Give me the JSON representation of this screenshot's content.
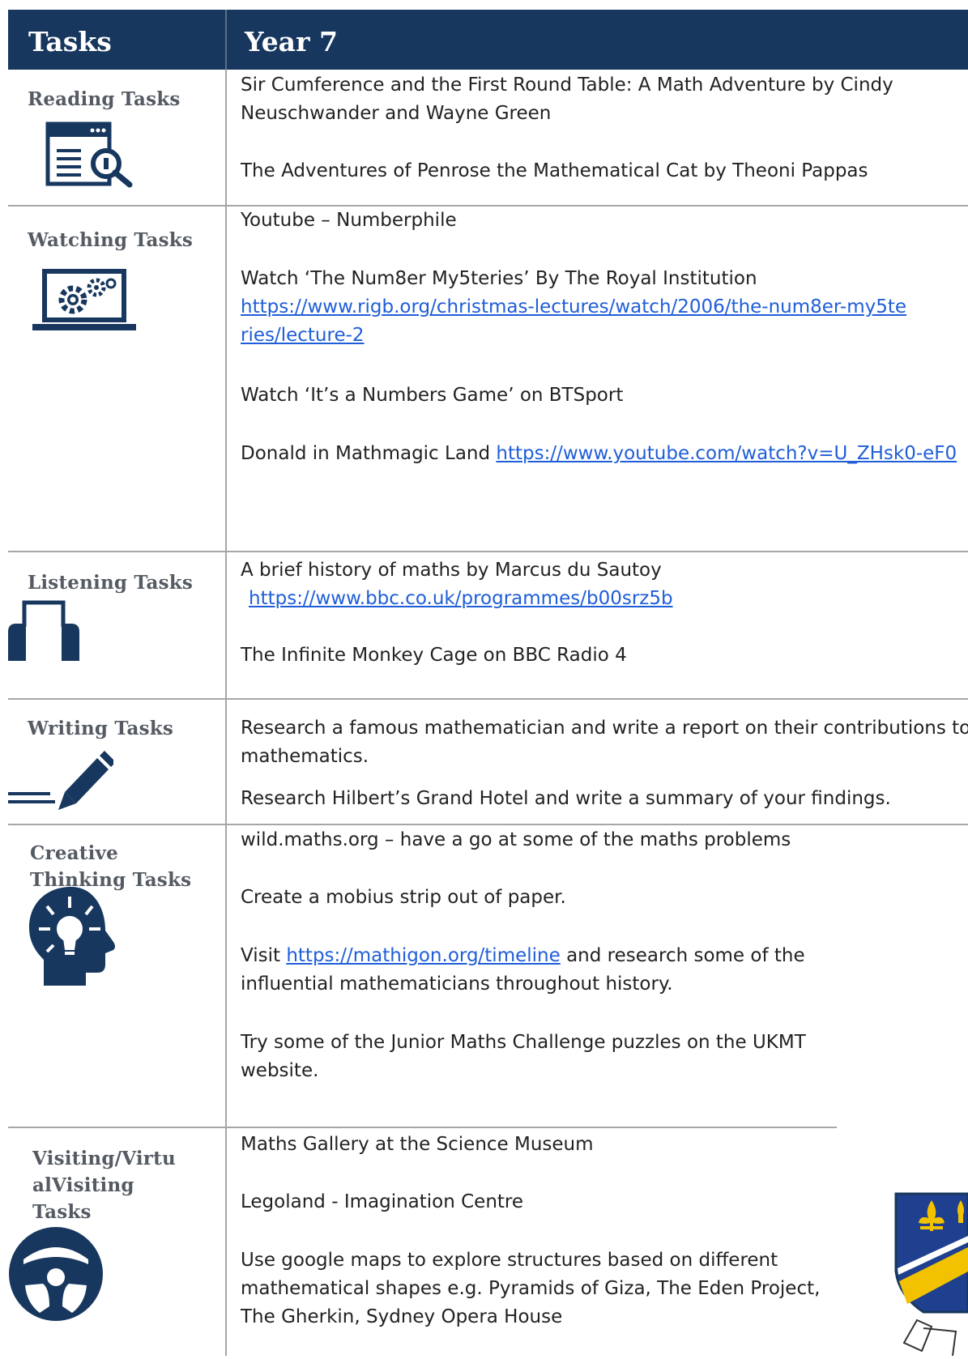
{
  "header": {
    "col1": "Tasks",
    "col2": "Year 7"
  },
  "sections": {
    "reading": {
      "title": "Reading Tasks",
      "icon": "document-search-icon",
      "items": [
        "Sir Cumference and the First Round Table: A Math Adventure by Cindy Neuschwander and Wayne Green",
        "The Adventures of Penrose the Mathematical Cat by Theoni Pappas"
      ]
    },
    "watching": {
      "title": "Watching Tasks",
      "icon": "laptop-gears-icon",
      "item1": "Youtube – Numberphile",
      "item2": "Watch ‘The Num8er My5teries’ By The Royal Institution",
      "item2_link": "https://www.rigb.org/christmas-lectures/watch/2006/the-num8er-my5teries/lecture-2",
      "item3": "Watch ‘It’s a Numbers Game’ on BTSport",
      "item4": "Donald in Mathmagic Land",
      "item4_link": "https://www.youtube.com/watch?v=U_ZHsk0-eF0"
    },
    "listening": {
      "title": "Listening Tasks",
      "icon": "headphones-icon",
      "item1": "A brief history of maths by Marcus du Sautoy",
      "item1_link": "https://www.bbc.co.uk/programmes/b00srz5b",
      "item2": "The Infinite Monkey Cage on BBC Radio 4"
    },
    "writing": {
      "title": "Writing Tasks",
      "icon": "pen-writing-icon",
      "item1": "Research a famous mathematician and write a report on their contributions to mathematics.",
      "item2": "Research Hilbert’s Grand Hotel and write a summary of your findings."
    },
    "creative": {
      "title_line1": "Creative",
      "title_line2": "Thinking Tasks",
      "icon": "head-lightbulb-icon",
      "item1": "wild.maths.org – have a go at some of the maths problems",
      "item2": "Create a mobius strip out of paper.",
      "item3_pre": "Visit",
      "item3_link": "https://mathigon.org/timeline",
      "item3_post": "and research some of the influential mathematicians throughout history.",
      "item4": "Try some of the Junior Maths Challenge puzzles on the UKMT website."
    },
    "visiting": {
      "title_line1": "Visiting/Virtu",
      "title_line2": "alVisiting",
      "title_line3": "Tasks",
      "icon": "steering-wheel-icon",
      "item1": "Maths Gallery at the Science Museum",
      "item2": "Legoland - Imagination Centre",
      "item3": "Use google maps to explore structures based on different mathematical shapes e.g. Pyramids of Giza, The Eden Project, The Gherkin, Sydney Opera House"
    }
  },
  "crest": {
    "icon": "school-crest-icon",
    "colors": [
      "#1f3f8f",
      "#f2c200"
    ]
  }
}
